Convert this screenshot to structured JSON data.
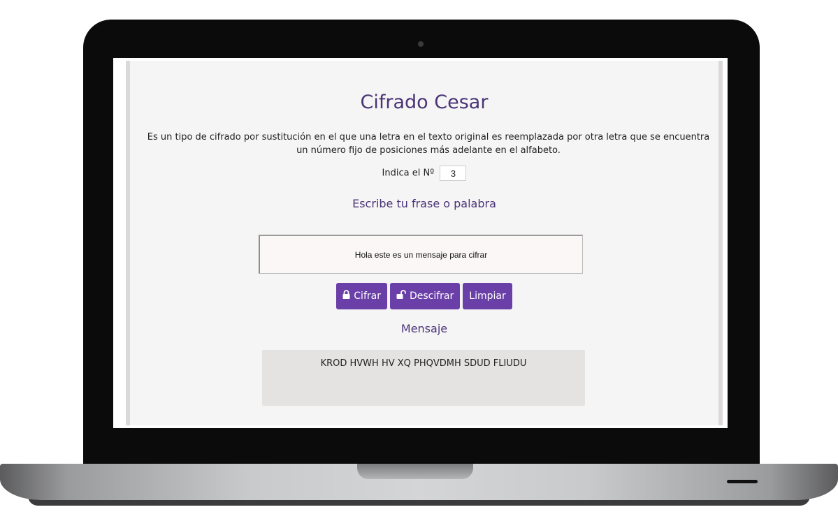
{
  "page": {
    "title": "Cifrado Cesar",
    "description": "Es un tipo de cifrado por sustitución en el que una letra en el texto original es reemplazada por otra letra que se encuentra un número fijo de posiciones más adelante en el alfabeto.",
    "shift_label": "Indica el Nº",
    "shift_value": "3",
    "prompt_label": "Escribe tu frase o palabra",
    "input_text": "Hola este es un mensaje para cifrar",
    "buttons": {
      "encrypt": "Cifrar",
      "decrypt": "Descifrar",
      "clear": "Limpiar"
    },
    "message_label": "Mensaje",
    "output_text": "KROD HVWH HV XQ PHQVDMH SDUD FLIUDU"
  },
  "colors": {
    "accent": "#6a3fa8",
    "heading": "#4a3476"
  },
  "icons": {
    "encrypt": "lock-icon",
    "decrypt": "unlock-icon"
  }
}
